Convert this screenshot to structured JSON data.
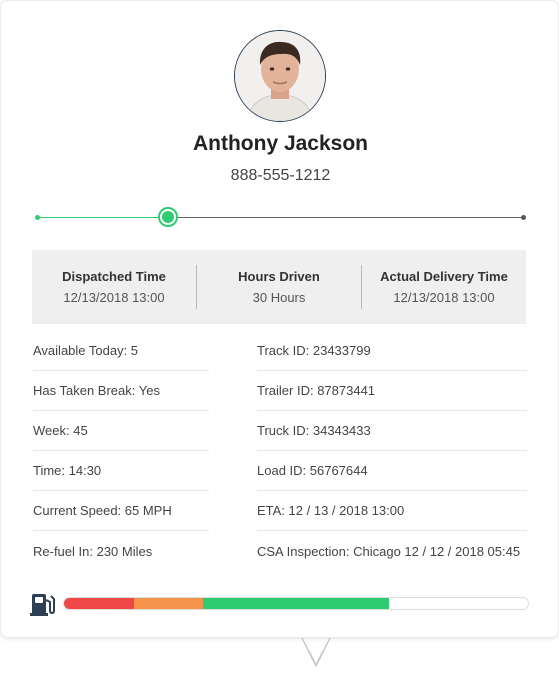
{
  "driver": {
    "name": "Anthony Jackson",
    "phone": "888-555-1212"
  },
  "trip_progress": 0.268,
  "stats": [
    {
      "label": "Dispatched Time",
      "value": "12/13/2018 13:00"
    },
    {
      "label": "Hours Driven",
      "value": "30 Hours"
    },
    {
      "label": "Actual Delivery Time",
      "value": "12/13/2018 13:00"
    }
  ],
  "details_left": [
    "Available Today: 5",
    "Has Taken Break: Yes",
    "Week: 45",
    "Time: 14:30",
    "Current Speed: 65 MPH",
    "Re-fuel In: 230 Miles"
  ],
  "details_right": [
    "Track ID: 23433799",
    "Trailer ID: 87873441",
    "Truck ID: 34343433",
    "Load ID: 56767644",
    "ETA: 12 / 13 / 2018 13:00",
    "CSA Inspection: Chicago 12 / 12 / 2018 05:45"
  ],
  "fuel_level": {
    "segments": [
      {
        "fraction": 0.15,
        "color": "#f04848"
      },
      {
        "fraction": 0.15,
        "color": "#f5934a"
      },
      {
        "fraction": 0.4,
        "color": "#2ecc71"
      }
    ]
  },
  "colors": {
    "accent": "#2ecc71",
    "panel": "#efefef"
  },
  "icons": {
    "fuel": "fuel-pump-icon",
    "expand": "chevron-down-icon"
  }
}
